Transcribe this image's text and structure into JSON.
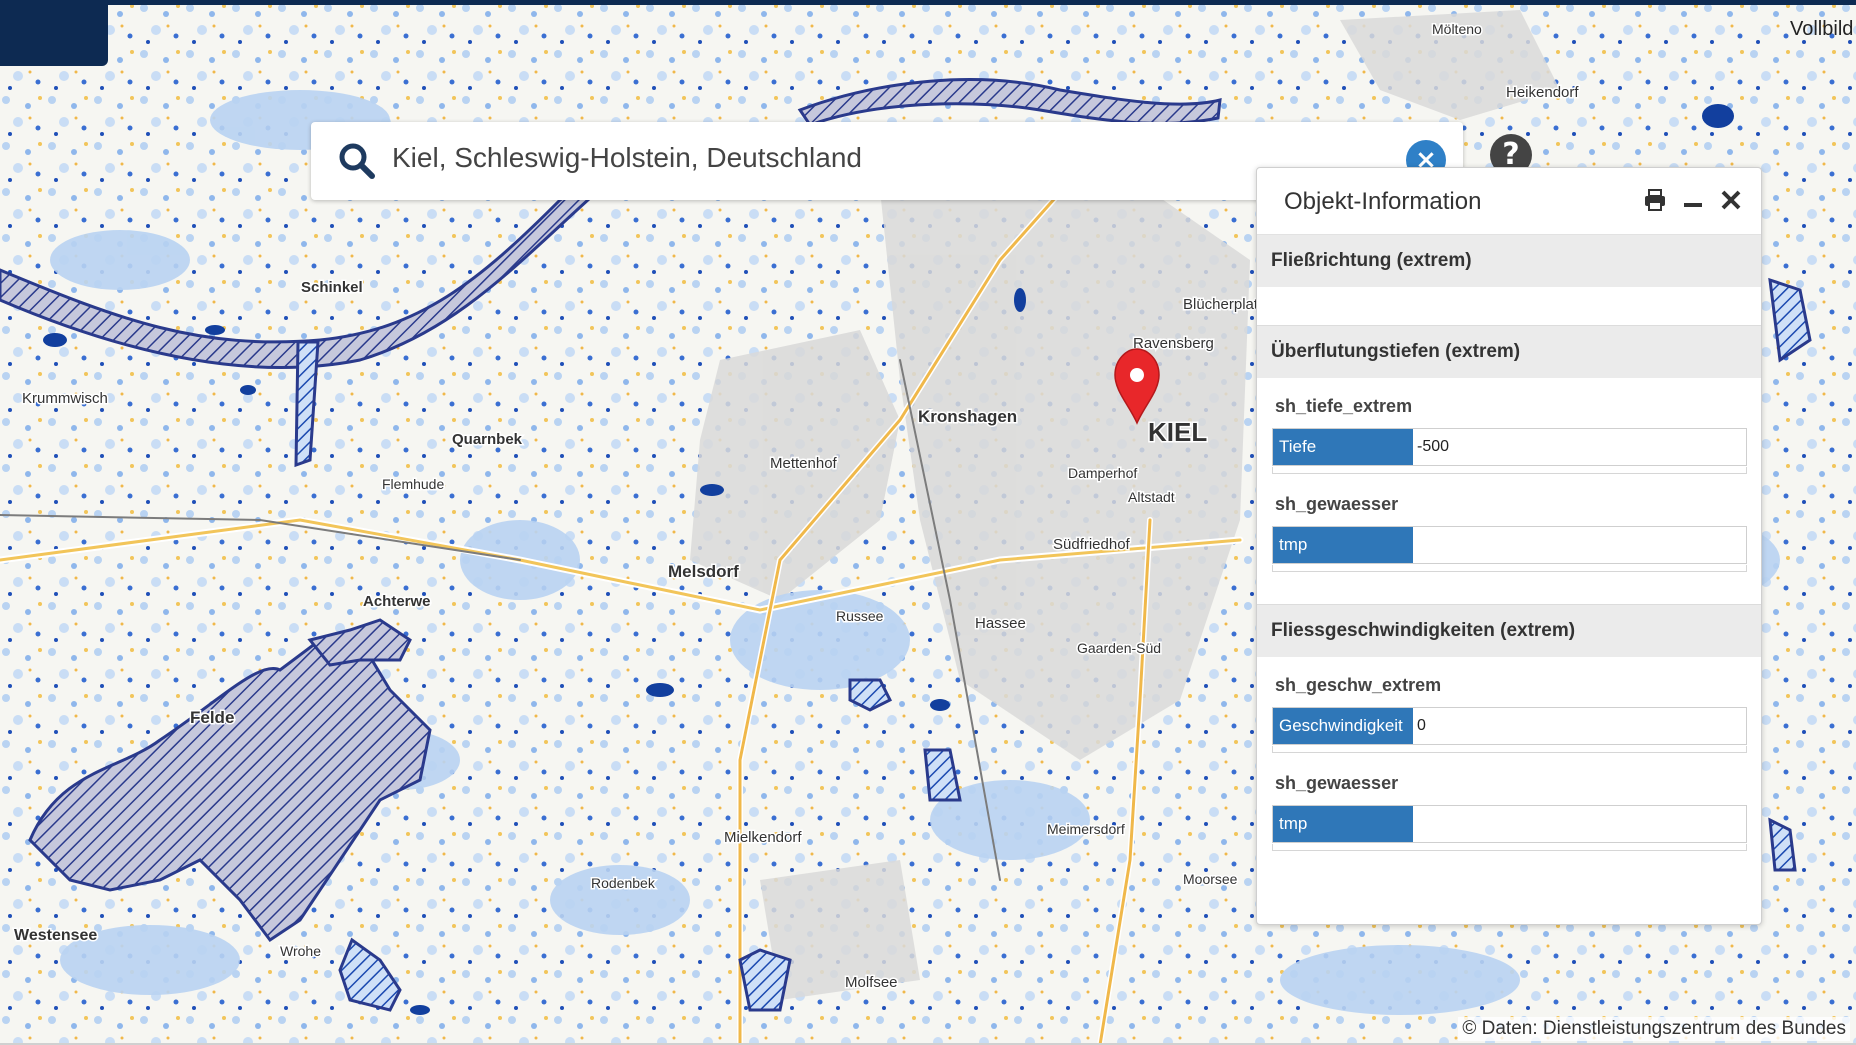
{
  "search": {
    "value": "Kiel, Schleswig-Holstein, Deutschland"
  },
  "header": {
    "vollbild_label": "Vollbild"
  },
  "panel": {
    "title": "Objekt-Information",
    "sections": [
      {
        "heading": "Fließrichtung (extrem)"
      },
      {
        "heading": "Überflutungstiefen (extrem)",
        "fields": [
          {
            "name": "sh_tiefe_extrem",
            "key": "Tiefe",
            "value": "-500"
          },
          {
            "name": "sh_gewaesser",
            "key": "tmp",
            "value": ""
          }
        ]
      },
      {
        "heading": "Fliessgeschwindigkeiten (extrem)",
        "fields": [
          {
            "name": "sh_geschw_extrem",
            "key": "Geschwindigkeit",
            "value": "0"
          },
          {
            "name": "sh_gewaesser",
            "key": "tmp",
            "value": ""
          }
        ]
      }
    ]
  },
  "map": {
    "attribution": "© Daten: Dienstleistungszentrum des Bundes",
    "labels": {
      "kiel": "KIEL",
      "kronshagen": "Kronshagen",
      "melsdorf": "Melsdorf",
      "mettenhof": "Mettenhof",
      "schinkel": "Schinkel",
      "krummwisch": "Krummwisch",
      "quarnbek": "Quarnbek",
      "achterwehr": "Achterwe",
      "felde": "Felde",
      "westensee": "Westensee",
      "suedfriedhof": "Südfriedhof",
      "ravensberg": "Ravensberg",
      "bluecherplatz": "Blücherplatz",
      "hassee": "Hassee",
      "molfsee": "Molfsee",
      "moorsee": "Moorsee",
      "heikendorf": "Heikendorf",
      "moeltenort": "Mölteno",
      "flemhude": "Flemhude",
      "russee": "Russee",
      "rodenbek": "Rodenbek",
      "mielkendorf": "Mielkendorf",
      "wrohe": "Wrohe",
      "gaarden": "Gaarden-Süd",
      "altstadt": "Altstadt",
      "damperhof": "Damperhof",
      "meimersdorf": "Meimersdorf"
    },
    "colors": {
      "flood_light": "#b9d3f2",
      "flood_mid": "#6d9fe6",
      "flood_dark": "#123f9e",
      "hatch": "#2a3a8c",
      "marker": "#e8272a",
      "accent": "#2f77b8"
    }
  }
}
